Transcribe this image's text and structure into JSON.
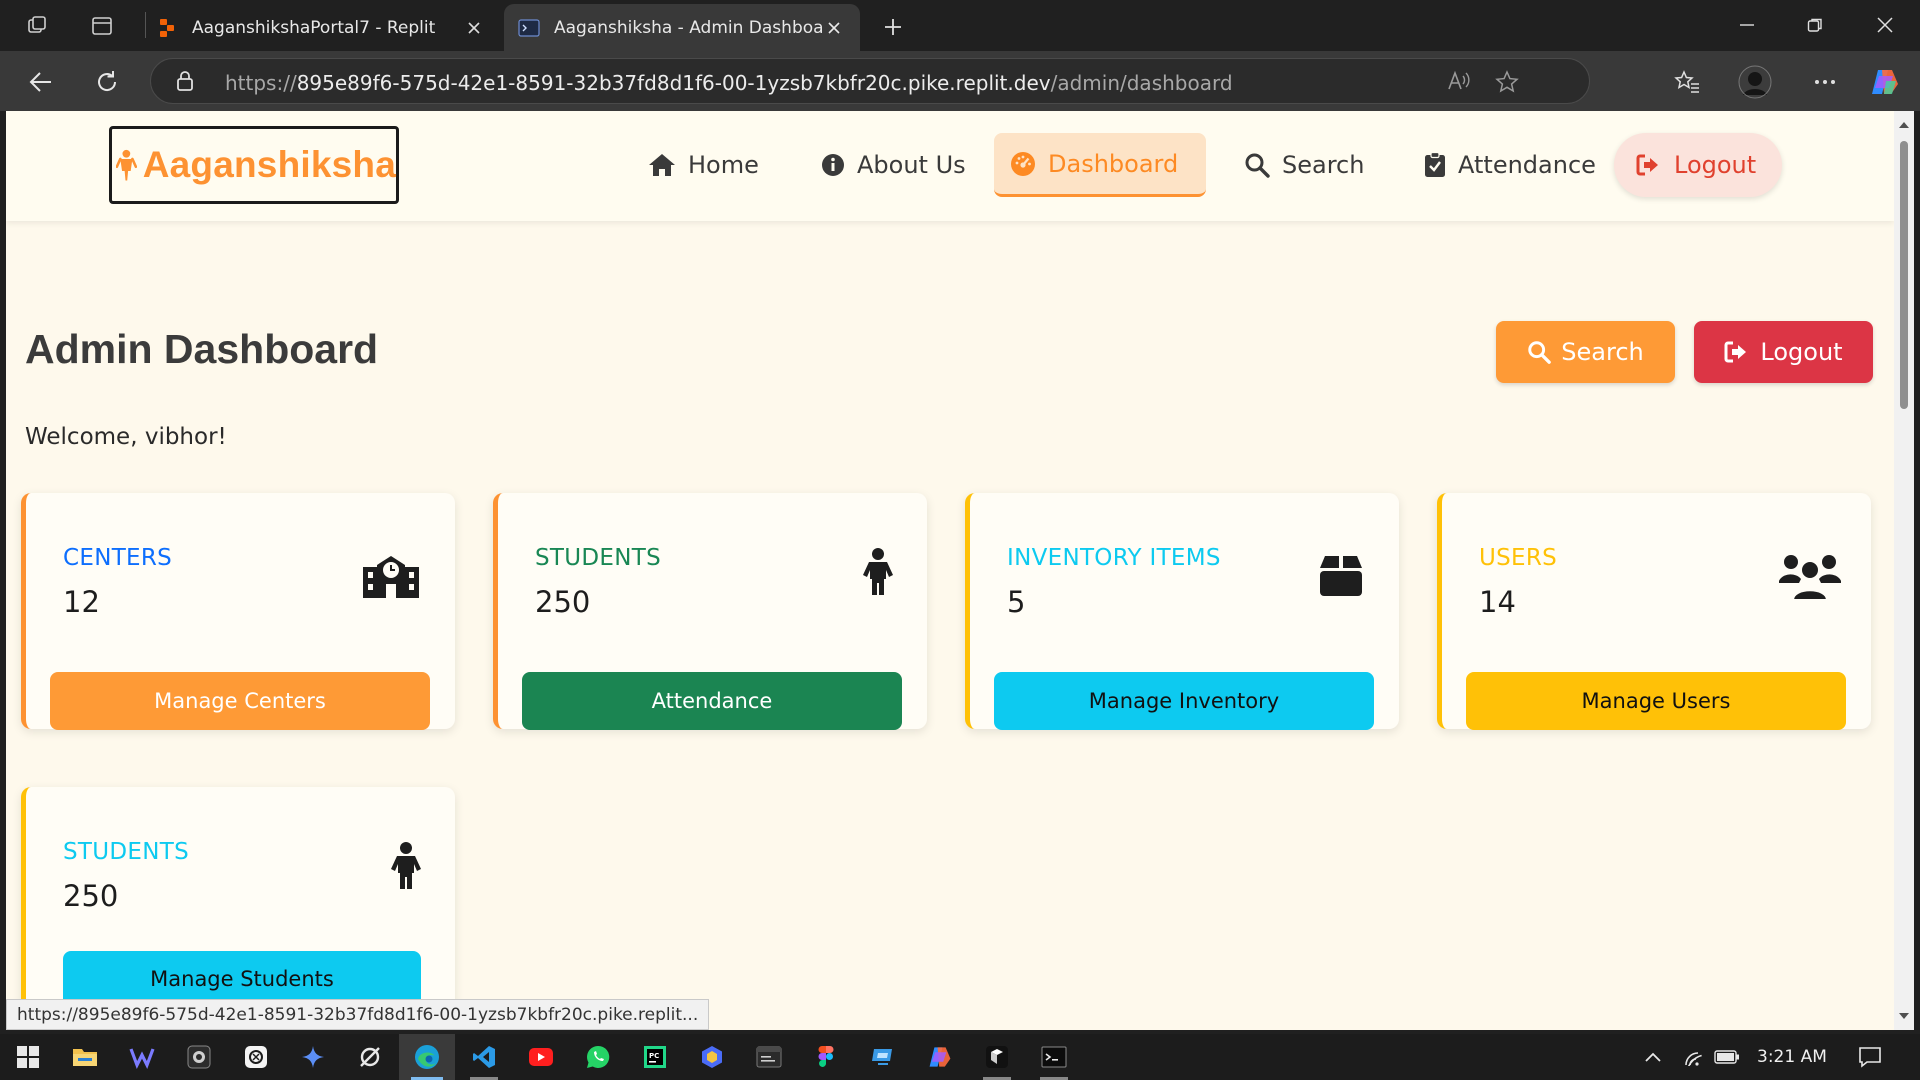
{
  "browser": {
    "tabs": [
      {
        "title": "AaganshikshaPortal7 - Replit",
        "active": false
      },
      {
        "title": "Aaganshiksha - Admin Dashboard",
        "active": true
      }
    ],
    "url": {
      "scheme": "https://",
      "host": "895e89f6-575d-42e1-8591-32b37fd8d1f6-00-1yzsb7kbfr20c.pike.replit.dev",
      "path": "/admin/dashboard"
    },
    "status_url": "https://895e89f6-575d-42e1-8591-32b37fd8d1f6-00-1yzsb7kbfr20c.pike.replit..."
  },
  "site": {
    "brand": "Aaganshiksha",
    "nav": [
      {
        "label": "Home",
        "icon": "home-icon"
      },
      {
        "label": "About Us",
        "icon": "info-icon"
      },
      {
        "label": "Dashboard",
        "icon": "gauge-icon",
        "active": true
      },
      {
        "label": "Search",
        "icon": "search-icon"
      },
      {
        "label": "Attendance",
        "icon": "clipboard-check-icon"
      },
      {
        "label": "Logout",
        "icon": "sign-out-icon"
      }
    ]
  },
  "dashboard": {
    "title": "Admin Dashboard",
    "welcome": "Welcome, vibhor!",
    "search_button": "Search",
    "logout_button": "Logout",
    "cards": [
      {
        "label": "CENTERS",
        "value": "12",
        "button": "Manage Centers",
        "icon": "school-icon",
        "label_color": "#0d6efd",
        "button_color": "#fe9a36",
        "button_text_color": "#ffffff",
        "border_color": "#fd9232"
      },
      {
        "label": "STUDENTS",
        "value": "250",
        "button": "Attendance",
        "icon": "child-icon",
        "label_color": "#198754",
        "button_color": "#1b8552",
        "button_text_color": "#ffffff",
        "border_color": "#fd9232"
      },
      {
        "label": "INVENTORY ITEMS",
        "value": "5",
        "button": "Manage Inventory",
        "icon": "box-icon",
        "label_color": "#0dcaf0",
        "button_color": "#0dcaf0",
        "button_text_color": "#111111",
        "border_color": "#ffc107"
      },
      {
        "label": "USERS",
        "value": "14",
        "button": "Manage Users",
        "icon": "users-icon",
        "label_color": "#ffc107",
        "button_color": "#ffc107",
        "button_text_color": "#111111",
        "border_color": "#ffc107"
      },
      {
        "label": "STUDENTS",
        "value": "250",
        "button": "Manage Students",
        "icon": "child-icon",
        "label_color": "#0dcaf0",
        "button_color": "#0dcaf0",
        "button_text_color": "#111111",
        "border_color": "#ffc107"
      }
    ]
  },
  "taskbar": {
    "clock": "3:21 AM"
  }
}
